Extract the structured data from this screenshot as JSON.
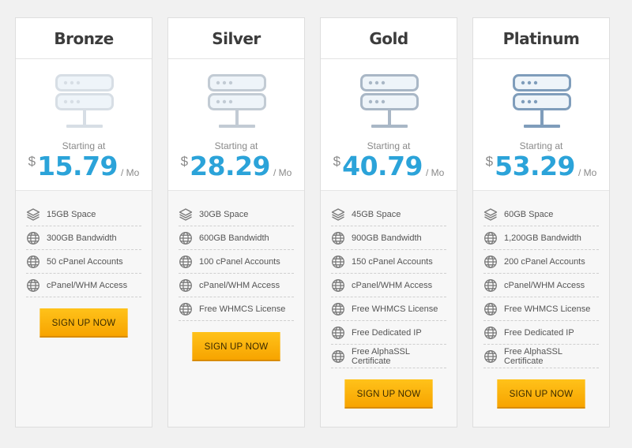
{
  "plans": [
    {
      "name": "Bronze",
      "starting": "Starting at",
      "currency": "$",
      "price": "15.79",
      "period": "/ Mo",
      "icon_color": "#d7dee5",
      "button": "SIGN UP NOW",
      "features": [
        {
          "icon": "layers-icon",
          "text": "15GB Space"
        },
        {
          "icon": "globe-icon",
          "text": "300GB Bandwidth"
        },
        {
          "icon": "globe-icon",
          "text": "50 cPanel Accounts"
        },
        {
          "icon": "globe-icon",
          "text": "cPanel/WHM Access"
        }
      ]
    },
    {
      "name": "Silver",
      "starting": "Starting at",
      "currency": "$",
      "price": "28.29",
      "period": "/ Mo",
      "icon_color": "#c2cbd4",
      "button": "SIGN UP NOW",
      "features": [
        {
          "icon": "layers-icon",
          "text": "30GB Space"
        },
        {
          "icon": "globe-icon",
          "text": "600GB Bandwidth"
        },
        {
          "icon": "globe-icon",
          "text": "100 cPanel Accounts"
        },
        {
          "icon": "globe-icon",
          "text": "cPanel/WHM Access"
        },
        {
          "icon": "globe-icon",
          "text": "Free WHMCS License"
        }
      ]
    },
    {
      "name": "Gold",
      "starting": "Starting at",
      "currency": "$",
      "price": "40.79",
      "period": "/ Mo",
      "icon_color": "#a9b7c6",
      "button": "SIGN UP NOW",
      "features": [
        {
          "icon": "layers-icon",
          "text": "45GB Space"
        },
        {
          "icon": "globe-icon",
          "text": "900GB Bandwidth"
        },
        {
          "icon": "globe-icon",
          "text": "150 cPanel Accounts"
        },
        {
          "icon": "globe-icon",
          "text": "cPanel/WHM Access"
        },
        {
          "icon": "globe-icon",
          "text": "Free WHMCS License"
        },
        {
          "icon": "globe-icon",
          "text": "Free Dedicated IP"
        },
        {
          "icon": "globe-icon",
          "text": "Free AlphaSSL Certificate"
        }
      ]
    },
    {
      "name": "Platinum",
      "starting": "Starting at",
      "currency": "$",
      "price": "53.29",
      "period": "/ Mo",
      "icon_color": "#7f9dbb",
      "button": "SIGN UP NOW",
      "features": [
        {
          "icon": "layers-icon",
          "text": "60GB Space"
        },
        {
          "icon": "globe-icon",
          "text": "1,200GB Bandwidth"
        },
        {
          "icon": "globe-icon",
          "text": "200 cPanel Accounts"
        },
        {
          "icon": "globe-icon",
          "text": "cPanel/WHM Access"
        },
        {
          "icon": "globe-icon",
          "text": "Free WHMCS License"
        },
        {
          "icon": "globe-icon",
          "text": "Free Dedicated IP"
        },
        {
          "icon": "globe-icon",
          "text": "Free AlphaSSL Certificate"
        }
      ]
    }
  ],
  "colors": {
    "price": "#2ba3d9",
    "button": "#ffb400",
    "page_bg": "#f1f1f1"
  }
}
